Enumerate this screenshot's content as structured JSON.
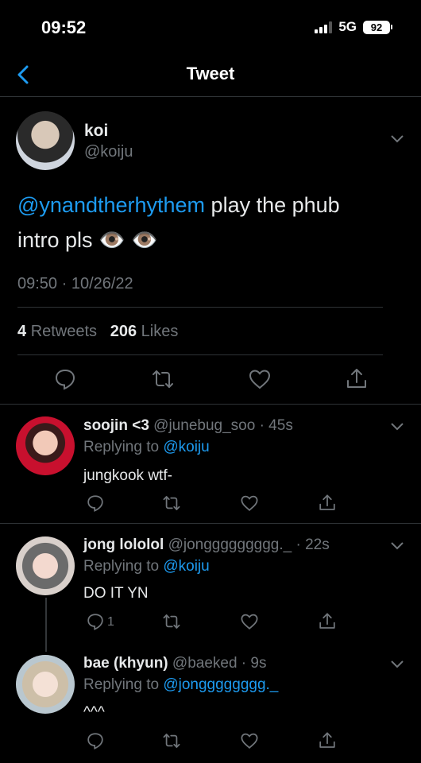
{
  "status_bar": {
    "time": "09:52",
    "network": "5G",
    "battery": "92"
  },
  "header": {
    "title": "Tweet"
  },
  "tweet": {
    "name": "koi",
    "handle": "@koiju",
    "mention": "@ynandtherhythem",
    "text_line1": " play the phub",
    "text_line2": "intro pls 👁️ 👁️",
    "timestamp": "09:50 · 10/26/22",
    "retweets_count": "4",
    "retweets_label": "Retweets",
    "likes_count": "206",
    "likes_label": "Likes"
  },
  "replies": [
    {
      "name": "soojin <3",
      "handle": "@junebug_soo",
      "time": " · 45s",
      "replying_to_label": "Replying to ",
      "replying_to": "@koiju",
      "text": "jungkook wtf-",
      "reply_count": ""
    },
    {
      "name": "jong lololol",
      "handle": "@jonggggggggg._",
      "time": " · 22s",
      "replying_to_label": "Replying to ",
      "replying_to": "@koiju",
      "text": "DO IT YN",
      "reply_count": "1"
    },
    {
      "name": "bae (khyun)",
      "handle": "@baeked",
      "time": " · 9s",
      "replying_to_label": "Replying to ",
      "replying_to": "@jongggggggg._",
      "text": "^^^",
      "reply_count": ""
    }
  ],
  "icons": {
    "back": "chevron-left-icon",
    "reply": "speech-bubble-icon",
    "retweet": "retweet-icon",
    "like": "heart-icon",
    "share": "share-icon",
    "more": "chevron-down-icon"
  },
  "colors": {
    "accent": "#1d9bf0",
    "background": "#000000",
    "muted": "#71767b"
  }
}
